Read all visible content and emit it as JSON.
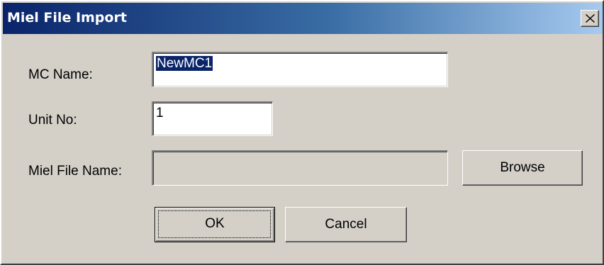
{
  "window": {
    "title": "Miel File Import",
    "close_icon": "close-icon"
  },
  "form": {
    "mc_name": {
      "label": "MC Name:",
      "value": "NewMC1"
    },
    "unit_no": {
      "label": "Unit No:",
      "value": "1"
    },
    "miel_file_name": {
      "label": "Miel File Name:",
      "value": "",
      "enabled": false
    }
  },
  "buttons": {
    "browse": "Browse",
    "ok": "OK",
    "cancel": "Cancel"
  },
  "colors": {
    "title_gradient_start": "#0a246a",
    "title_gradient_end": "#a6caf0",
    "face": "#d4d0c8",
    "selection": "#0a246a"
  }
}
